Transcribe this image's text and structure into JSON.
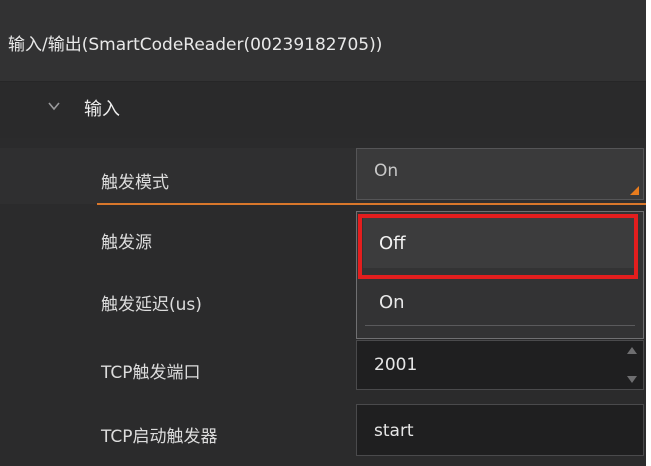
{
  "title": "输入/输出(SmartCodeReader(00239182705))",
  "section": {
    "label": "输入",
    "icon": "chevron-down-icon"
  },
  "properties": [
    {
      "label": "触发模式",
      "value": "On",
      "control": "select"
    },
    {
      "label": "触发源",
      "value": "",
      "control": "select"
    },
    {
      "label": "触发延迟(us)",
      "value": "",
      "control": "number"
    },
    {
      "label": "TCP触发端口",
      "value": "2001",
      "control": "spinbox"
    },
    {
      "label": "TCP启动触发器",
      "value": "start",
      "control": "text"
    }
  ],
  "dropdown": {
    "options": [
      "Off",
      "On"
    ],
    "highlighted": "Off"
  },
  "colors": {
    "accent": "#e87c1e",
    "highlight": "#e31e1e",
    "panel": "#2b2b2c"
  }
}
